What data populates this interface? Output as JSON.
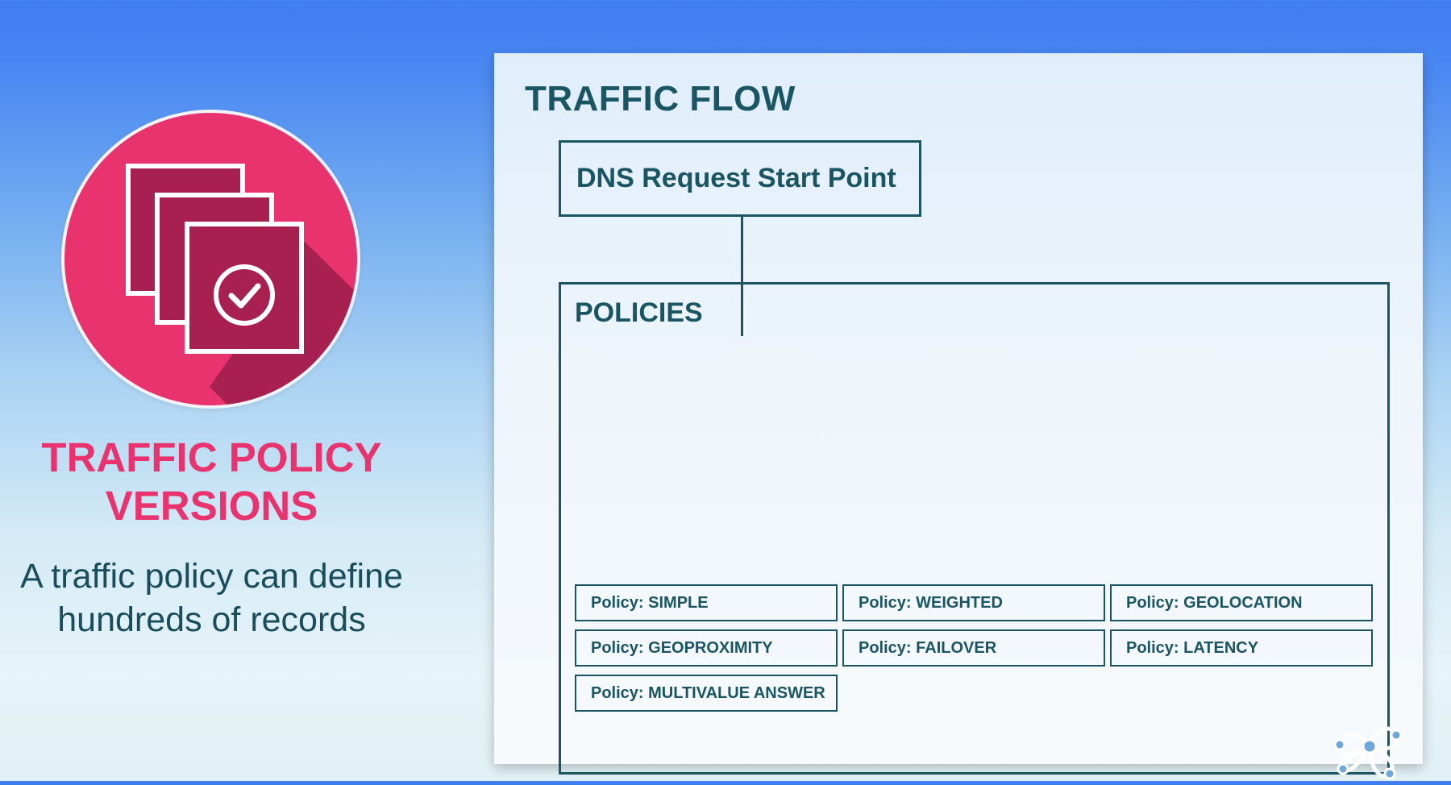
{
  "left": {
    "icon_name": "stacked-documents-check-icon",
    "title_line1": "TRAFFIC POLICY",
    "title_line2": "VERSIONS",
    "subtitle_line1": "A traffic policy can define",
    "subtitle_line2": "hundreds of records",
    "accent_color": "#e9336f"
  },
  "diagram": {
    "title": "TRAFFIC FLOW",
    "start_point": "DNS Request Start Point",
    "policies_title": "POLICIES",
    "policies": [
      "Policy: SIMPLE",
      "Policy: WEIGHTED",
      "Policy: GEOLOCATION",
      "Policy: GEOPROXIMITY",
      "Policy: FAILOVER",
      "Policy: LATENCY",
      "Policy: MULTIVALUE ANSWER"
    ],
    "line_color": "#1a5563"
  },
  "logo_icon": "network-nodes-logo-icon"
}
